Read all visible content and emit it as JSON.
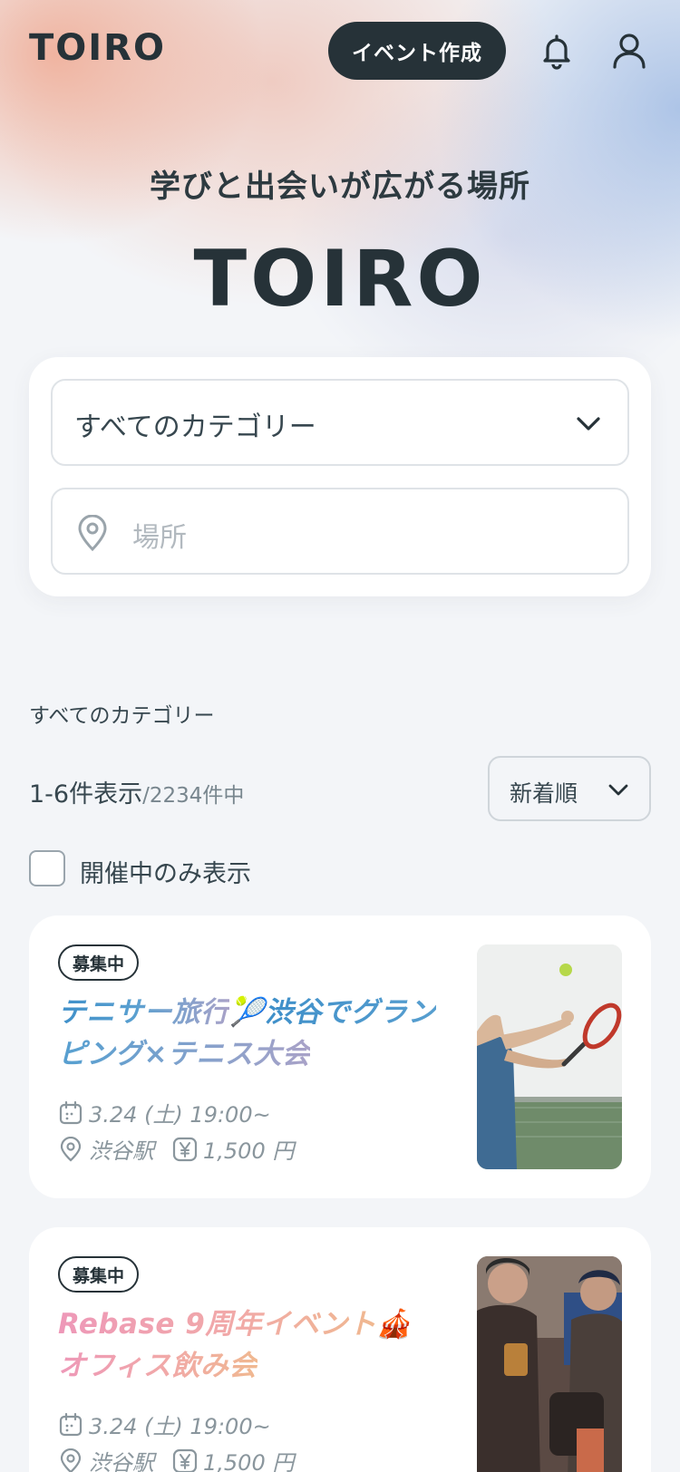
{
  "header": {
    "logo": "TOIRO",
    "create_button": "イベント作成"
  },
  "hero": {
    "tagline": "学びと出会いが広がる場所",
    "title": "TOIRO"
  },
  "search": {
    "category_value": "すべてのカテゴリー",
    "place_placeholder": "場所"
  },
  "list": {
    "category_caption": "すべてのカテゴリー",
    "count_shown": "1-6件表示",
    "count_total": "/2234件中",
    "sort_label": "新着順",
    "ongoing_only_label": "開催中のみ表示"
  },
  "events": [
    {
      "badge": "募集中",
      "title_a": "テニサー旅行",
      "title_emoji": "🎾",
      "title_b": "渋谷でグランピング×テニス大会",
      "date": "3.24 (土)  19:00~",
      "place": "渋谷駅",
      "price": "1,500 円"
    },
    {
      "badge": "募集中",
      "title_a": "Rebase 9周年イベント",
      "title_emoji": "🎪",
      "title_b": "オフィス飲み会",
      "date": "3.24 (土)  19:00~",
      "place": "渋谷駅",
      "price": "1,500 円"
    }
  ]
}
